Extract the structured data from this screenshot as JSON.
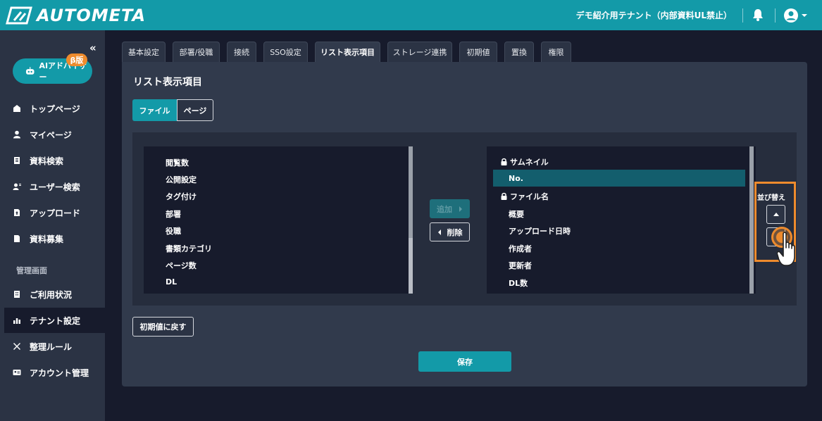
{
  "header": {
    "logo_text": "AUTOMETA",
    "tenant_name": "デモ紹介用テナント（内部資料UL禁止）"
  },
  "sidebar": {
    "ai_button": "AIアドバイザー",
    "beta_badge": "β版",
    "items": [
      {
        "label": "トップページ",
        "icon": "home-icon"
      },
      {
        "label": "マイページ",
        "icon": "user-icon"
      },
      {
        "label": "資料検索",
        "icon": "document-search-icon"
      },
      {
        "label": "ユーザー検索",
        "icon": "user-search-icon"
      },
      {
        "label": "アップロード",
        "icon": "upload-icon"
      },
      {
        "label": "資料募集",
        "icon": "file-icon"
      }
    ],
    "admin_section": "管理画面",
    "admin_items": [
      {
        "label": "ご利用状況",
        "icon": "building-icon"
      },
      {
        "label": "テナント設定",
        "icon": "chart-icon"
      },
      {
        "label": "整理ルール",
        "icon": "tools-icon"
      },
      {
        "label": "アカウント管理",
        "icon": "id-card-icon"
      }
    ]
  },
  "tabs": [
    "基本設定",
    "部署/役職",
    "接続",
    "SSO設定",
    "リスト表示項目",
    "ストレージ連携",
    "初期値",
    "置換",
    "権限"
  ],
  "active_tab": "リスト表示項目",
  "main": {
    "title": "リスト表示項目",
    "segment": {
      "file": "ファイル",
      "page": "ページ"
    },
    "available_items": [
      "閲覧数",
      "公開設定",
      "タグ付け",
      "部署",
      "役職",
      "書類カテゴリ",
      "ページ数",
      "DL"
    ],
    "selected_items": [
      {
        "label": "サムネイル",
        "locked": true
      },
      {
        "label": "No.",
        "locked": false,
        "highlighted": true
      },
      {
        "label": "ファイル名",
        "locked": true
      },
      {
        "label": "概要",
        "locked": false
      },
      {
        "label": "アップロード日時",
        "locked": false
      },
      {
        "label": "作成者",
        "locked": false
      },
      {
        "label": "更新者",
        "locked": false
      },
      {
        "label": "DL数",
        "locked": false
      }
    ],
    "add_button": "追加",
    "delete_button": "削除",
    "sort_label": "並び替え",
    "reset_button": "初期値に戻す",
    "save_button": "保存"
  },
  "colors": {
    "header": "#139aa8",
    "sidebar": "#2b3344",
    "panel": "#313a4c",
    "accent": "#139aa8",
    "highlight": "#ee8b2d"
  }
}
